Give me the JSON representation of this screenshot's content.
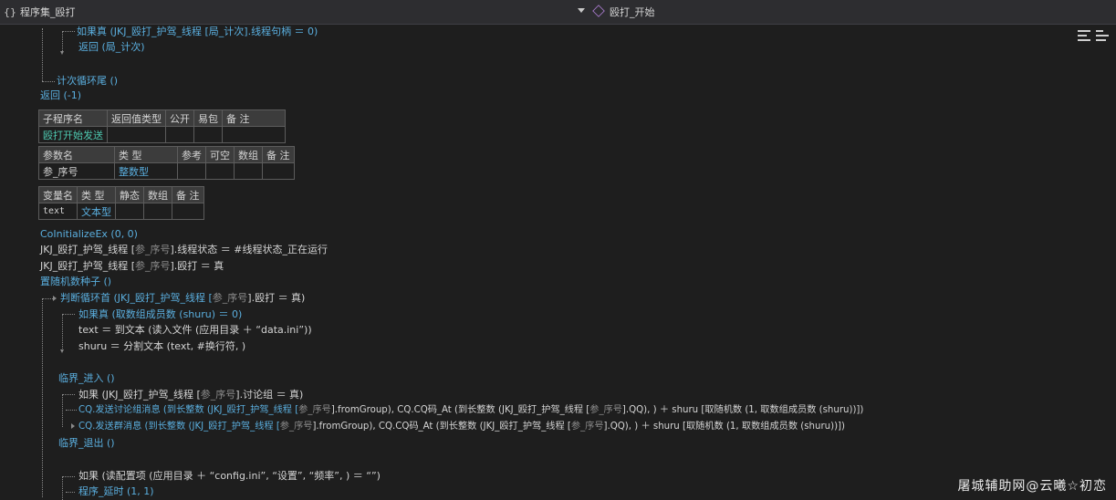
{
  "header": {
    "brace": "{}",
    "left_title": "程序集_殴打",
    "right_title": "殴打_开始"
  },
  "code": {
    "l1": "如果真 (JKJ_殴打_护驾_线程 [局_计次].线程句柄 ＝ 0)",
    "l2": "返回 (局_计次)",
    "l3": "计次循环尾 ()",
    "l4": "返回 (-1)",
    "l5": "CoInitializeEx (0, 0)",
    "l6a": "JKJ_殴打_护驾_线程 [",
    "l6b": "参_序号",
    "l6c": "].线程状态 ＝ #线程状态_正在运行",
    "l7a": "JKJ_殴打_护驾_线程 [",
    "l7b": "参_序号",
    "l7c": "].殴打 ＝ 真",
    "l8": "置随机数种子 ()",
    "l9a": "判断循环首 (JKJ_殴打_护驾_线程 [",
    "l9b": "参_序号",
    "l9c": "].殴打 ＝ 真)",
    "l10": "如果真 (取数组成员数 (shuru) ＝ 0)",
    "l11": "text ＝ 到文本 (读入文件 (应用目录 ＋ “data.ini”))",
    "l12": "shuru ＝ 分割文本 (text, #换行符, )",
    "l13": "临界_进入 ()",
    "l14a": "如果 (JKJ_殴打_护驾_线程 [",
    "l14b": "参_序号",
    "l14c": "].讨论组 ＝ 真)",
    "l15a": "CQ.发送讨论组消息 (到长整数 (JKJ_殴打_护驾_线程 [",
    "l15b": "参_序号",
    "l15c": "].fromGroup), CQ.CQ码_At (到长整数 (JKJ_殴打_护驾_线程 [",
    "l15d": "参_序号",
    "l15e": "].QQ), ) ＋ shuru [取随机数 (1, 取数组成员数 (shuru))])",
    "l16a": "CQ.发送群消息 (到长整数 (JKJ_殴打_护驾_线程 [",
    "l16b": "参_序号",
    "l16c": "].fromGroup), CQ.CQ码_At (到长整数 (JKJ_殴打_护驾_线程 [",
    "l16d": "参_序号",
    "l16e": "].QQ), ) ＋ shuru [取随机数 (1, 取数组成员数 (shuru))])",
    "l17": "临界_退出 ()",
    "l18": "如果 (读配置项 (应用目录 ＋ “config.ini”, “设置”, “频率”, ) ＝ “”)",
    "l19": "程序_延时 (1, 1)"
  },
  "sub_table": {
    "headers": [
      "子程序名",
      "返回值类型",
      "公开",
      "易包",
      "备 注"
    ],
    "name": "殴打开始发送",
    "param_headers": [
      "参数名",
      "类 型",
      "参考",
      "可空",
      "数组",
      "备 注"
    ],
    "param_name": "参_序号",
    "param_type": "整数型"
  },
  "var_table": {
    "headers": [
      "变量名",
      "类 型",
      "静态",
      "数组",
      "备 注"
    ],
    "var_name": "text",
    "var_type": "文本型"
  },
  "watermark": "屠城辅助网@云曦☆初恋"
}
